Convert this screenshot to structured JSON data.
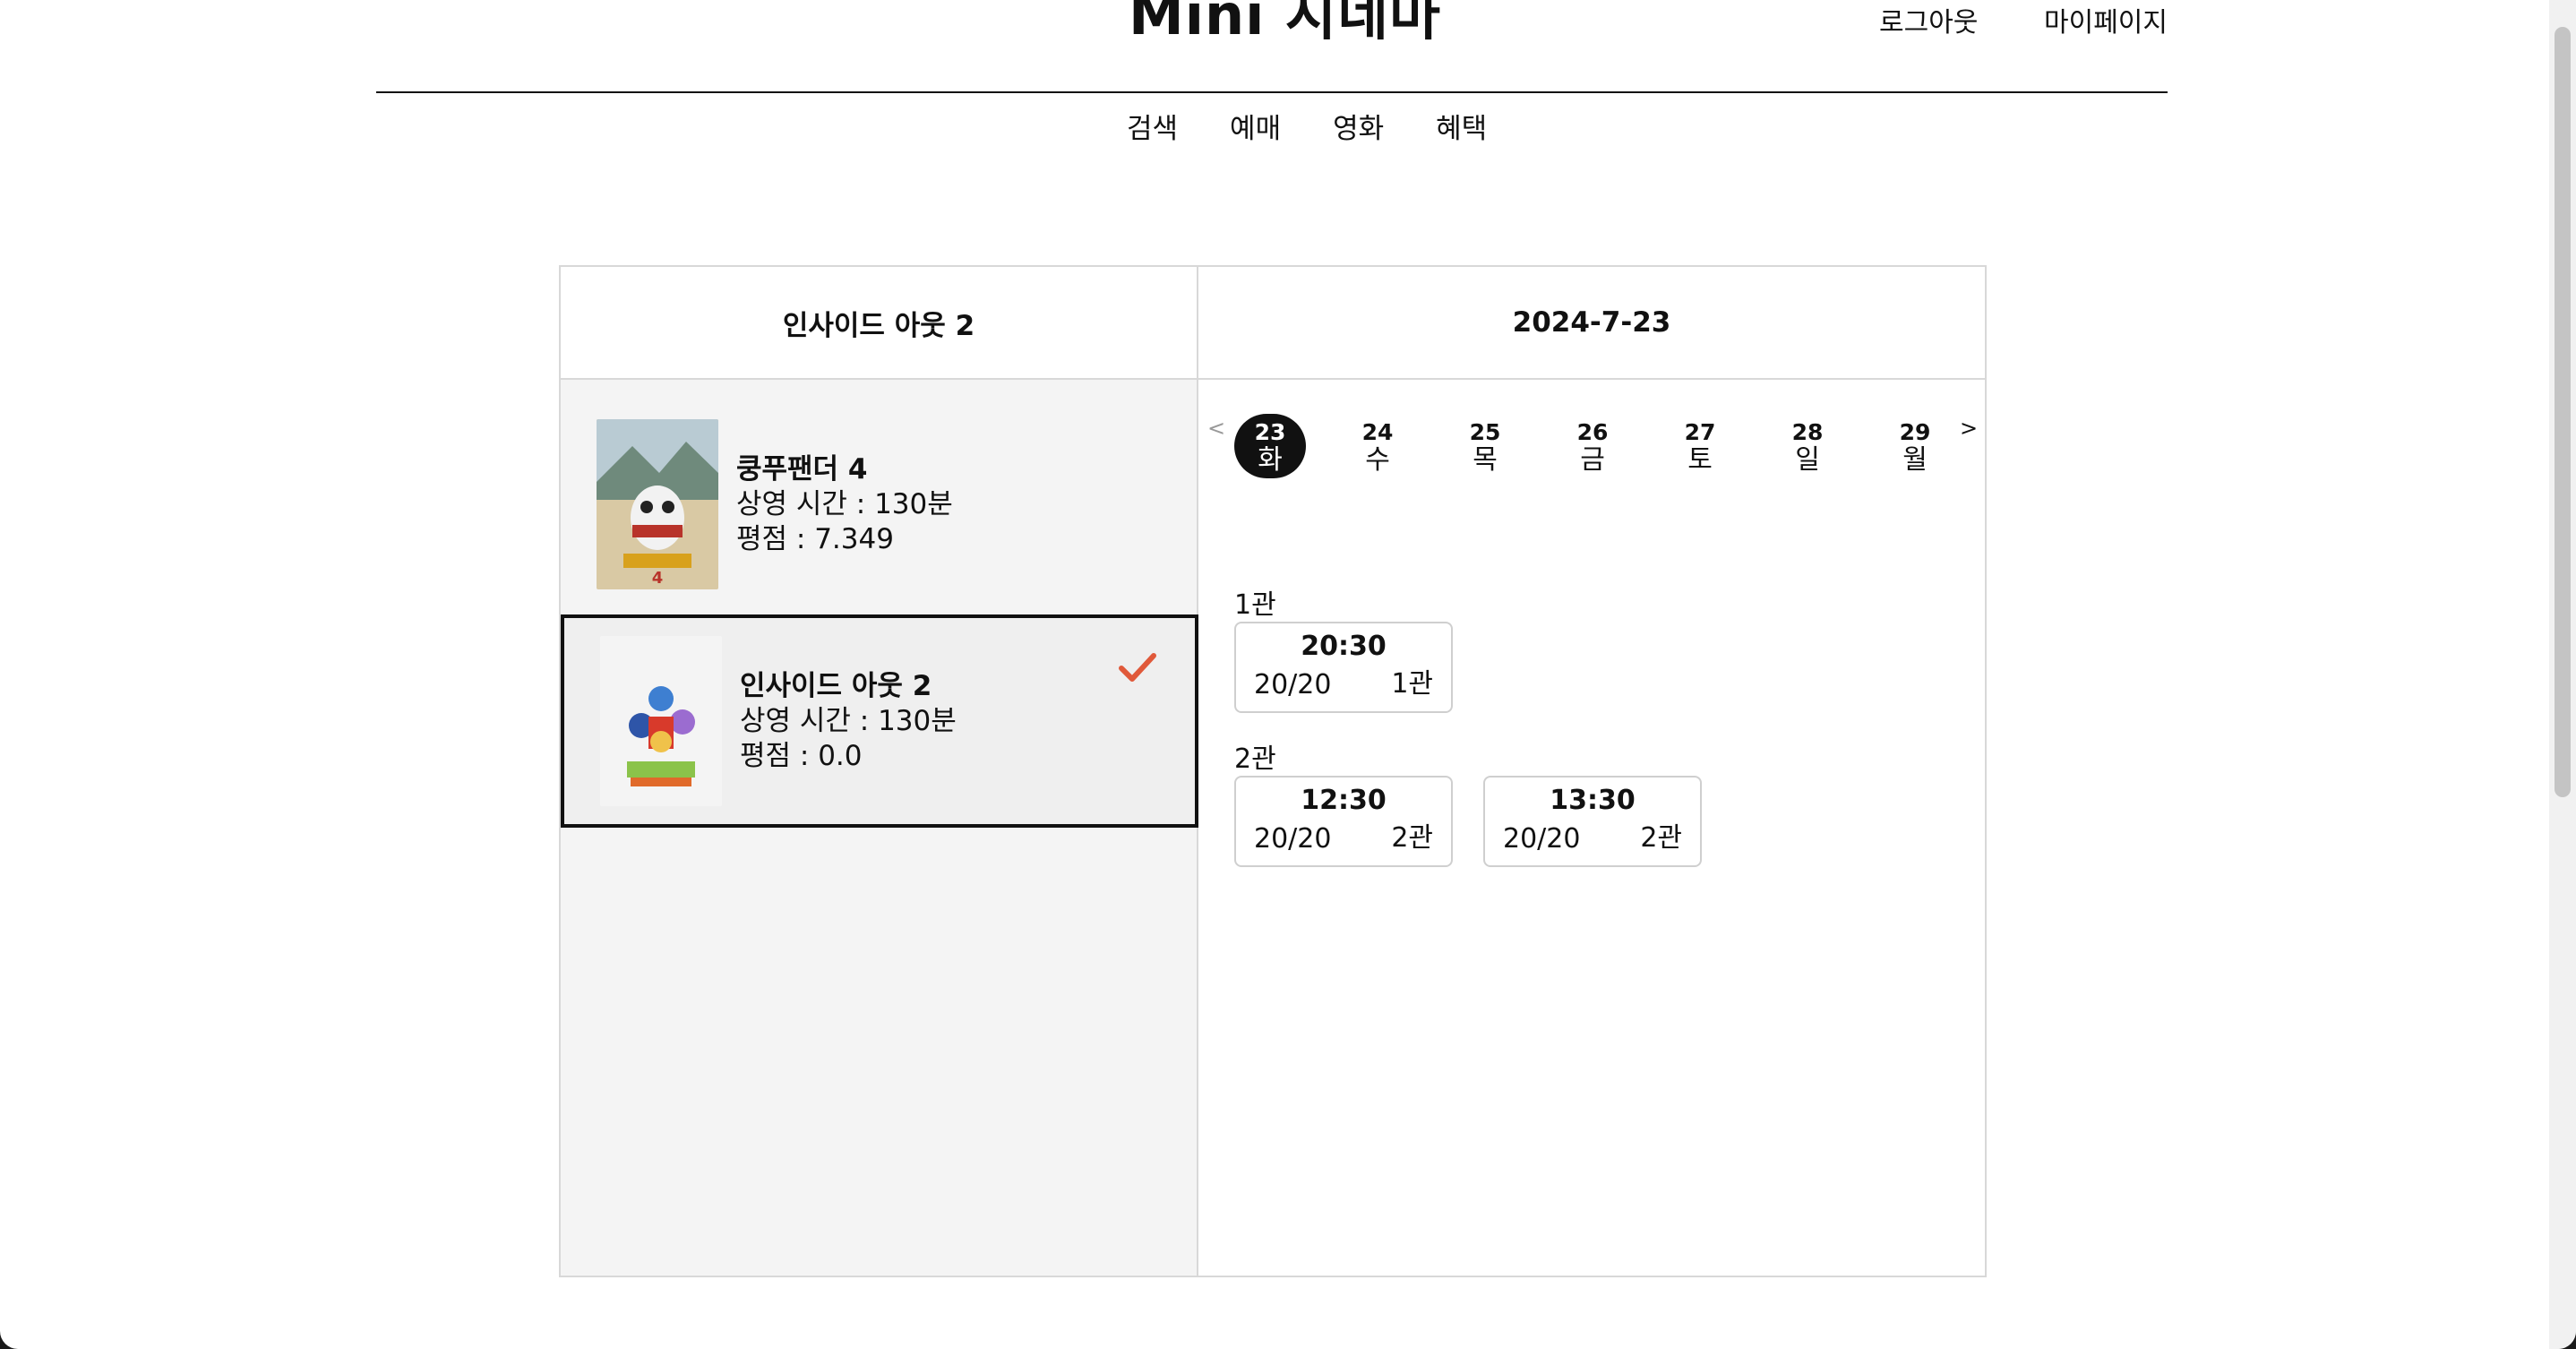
{
  "header": {
    "site_title": "Mini 시네마",
    "logout": "로그아웃",
    "mypage": "마이페이지"
  },
  "nav": [
    "검색",
    "예매",
    "영화",
    "혜택"
  ],
  "booking": {
    "selected_movie_title": "인사이드 아웃 2",
    "selected_date": "2024-7-23",
    "movies": [
      {
        "title": "쿵푸팬더 4",
        "runtime": "상영 시간 : 130분",
        "rating": "평점 : 7.349",
        "selected": false
      },
      {
        "title": "인사이드 아웃 2",
        "runtime": "상영 시간 : 130분",
        "rating": "평점 : 0.0",
        "selected": true
      }
    ],
    "dates": {
      "prev": "<",
      "next": ">",
      "days": [
        {
          "num": "23",
          "weekday": "화",
          "active": true
        },
        {
          "num": "24",
          "weekday": "수"
        },
        {
          "num": "25",
          "weekday": "목"
        },
        {
          "num": "26",
          "weekday": "금"
        },
        {
          "num": "27",
          "weekday": "토"
        },
        {
          "num": "28",
          "weekday": "일"
        },
        {
          "num": "29",
          "weekday": "월"
        }
      ]
    },
    "halls": [
      {
        "label": "1관",
        "slots": [
          {
            "time": "20:30",
            "seats": "20/20",
            "hall": "1관"
          }
        ]
      },
      {
        "label": "2관",
        "slots": [
          {
            "time": "12:30",
            "seats": "20/20",
            "hall": "2관"
          },
          {
            "time": "13:30",
            "seats": "20/20",
            "hall": "2관"
          }
        ]
      }
    ]
  },
  "colors": {
    "check": "#e0593a",
    "accent": "#111111"
  }
}
